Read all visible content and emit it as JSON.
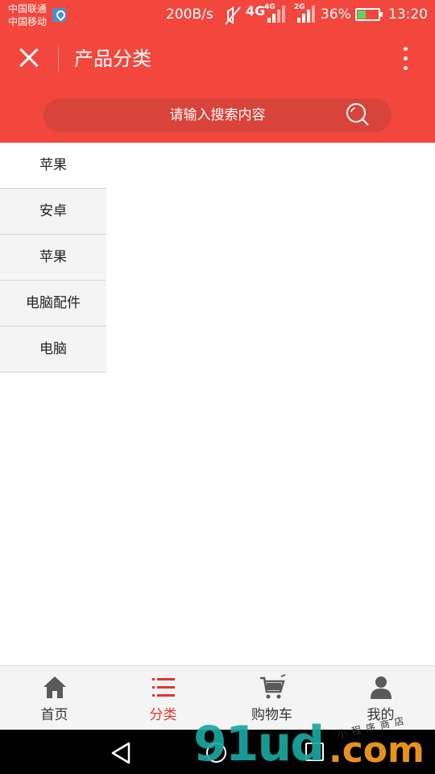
{
  "status_bar": {
    "carrier_1": "中国联通",
    "carrier_2": "中国移动",
    "net_speed": "200B/s",
    "network_4g": "4G",
    "sim1_tag": "4G",
    "sim2_tag": "2G",
    "battery_percent": "36%",
    "battery_level": 0.36,
    "time": "13:20",
    "icons": [
      "location-icon",
      "mute-icon",
      "signal-icon",
      "signal-icon",
      "battery-charging-icon"
    ]
  },
  "header": {
    "title": "产品分类",
    "close_icon": "close-icon",
    "more_icon": "more-vertical-icon",
    "accent_color": "#f3473d"
  },
  "search": {
    "placeholder": "请输入搜索内容",
    "icon": "search-icon"
  },
  "categories": {
    "items": [
      {
        "label": "苹果"
      },
      {
        "label": "安卓"
      },
      {
        "label": "苹果"
      },
      {
        "label": "电脑配件"
      },
      {
        "label": "电脑"
      }
    ]
  },
  "tabbar": {
    "active_color": "#e3362c",
    "tabs": [
      {
        "label": "首页",
        "icon": "home-icon"
      },
      {
        "label": "分类",
        "icon": "list-icon"
      },
      {
        "label": "购物车",
        "icon": "cart-icon"
      },
      {
        "label": "我的",
        "icon": "user-icon"
      }
    ]
  },
  "watermark": {
    "main": "91ud",
    "domain": ".com",
    "small": "小程序商店"
  }
}
